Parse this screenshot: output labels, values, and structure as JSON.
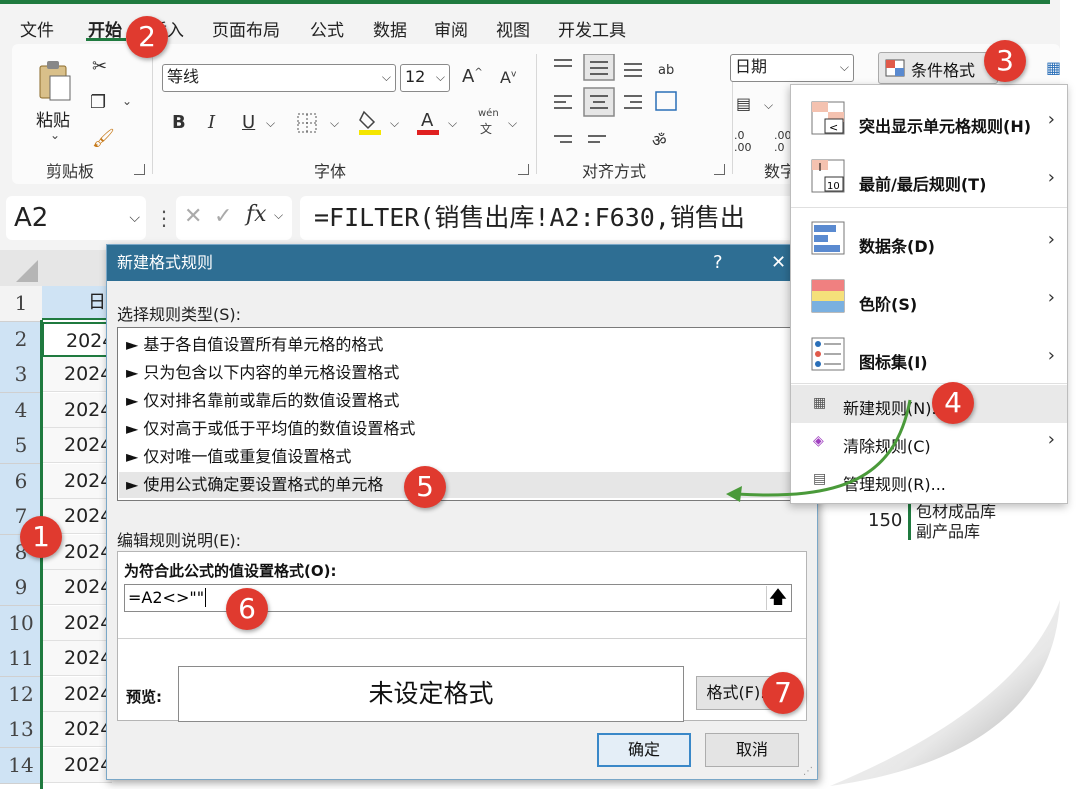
{
  "menu": {
    "items": [
      "文件",
      "开始",
      "插入",
      "页面布局",
      "公式",
      "数据",
      "审阅",
      "视图",
      "开发工具"
    ],
    "active": "开始"
  },
  "ribbon": {
    "clipboard": {
      "paste_label": "粘贴",
      "group_label": "剪贴板"
    },
    "font": {
      "font_name": "等线",
      "font_size": "12",
      "group_label": "字体",
      "bold": "B",
      "italic": "I",
      "underline": "U",
      "phonetic_top": "wén",
      "phonetic_bottom": "文"
    },
    "alignment": {
      "group_label": "对齐方式"
    },
    "number": {
      "format": "日期",
      "group_label": "数字",
      "dec_inc": ".0 .00",
      "dec_dec": ".00 .0"
    },
    "styles": {
      "conditional_label": "条件格式"
    }
  },
  "formula_bar": {
    "name_box": "A2",
    "fx": "fx",
    "formula": "=FILTER(销售出库!A2:F630,销售出"
  },
  "sheet": {
    "col_header": "日",
    "rows": [
      "1",
      "2",
      "3",
      "4",
      "5",
      "6",
      "7",
      "8",
      "9",
      "10",
      "11",
      "12",
      "13",
      "14"
    ],
    "cells": [
      "2024",
      "2024",
      "2024",
      "2024",
      "2024",
      "2024",
      "2024",
      "2024",
      "2024",
      "2024",
      "2024",
      "2024",
      "2024"
    ],
    "behind_number": "150",
    "behind_text1": "包材成品库",
    "behind_text2": "副产品库"
  },
  "dialog": {
    "title": "新建格式规则",
    "help": "?",
    "close": "✕",
    "select_type_label": "选择规则类型(S):",
    "rules": [
      "► 基于各自值设置所有单元格的格式",
      "► 只为包含以下内容的单元格设置格式",
      "► 仅对排名靠前或靠后的数值设置格式",
      "► 仅对高于或低于平均值的数值设置格式",
      "► 仅对唯一值或重复值设置格式",
      "► 使用公式确定要设置格式的单元格"
    ],
    "edit_label": "编辑规则说明(E):",
    "formula_label": "为符合此公式的值设置格式(O):",
    "formula_value": "=A2<>\"\"",
    "preview_label": "预览:",
    "preview_text": "未设定格式",
    "format_button": "格式(F)...",
    "ok": "确定",
    "cancel": "取消"
  },
  "dropdown": {
    "items": [
      {
        "label": "突出显示单元格规则(H)",
        "arrow": "›"
      },
      {
        "label": "最前/最后规则(T)",
        "arrow": "›"
      },
      {
        "label": "数据条(D)",
        "arrow": "›"
      },
      {
        "label": "色阶(S)",
        "arrow": "›"
      },
      {
        "label": "图标集(I)",
        "arrow": "›"
      },
      {
        "label": "新建规则(N)...",
        "arrow": ""
      },
      {
        "label": "清除规则(C)",
        "arrow": "›"
      },
      {
        "label": "管理规则(R)...",
        "arrow": ""
      }
    ]
  },
  "badges": [
    "1",
    "2",
    "3",
    "4",
    "5",
    "6",
    "7"
  ],
  "colors": {
    "badge": "#e03a2f",
    "accent": "#1f7a3f",
    "titlebar": "#2e6e93",
    "arrow": "#4a9a3a"
  }
}
